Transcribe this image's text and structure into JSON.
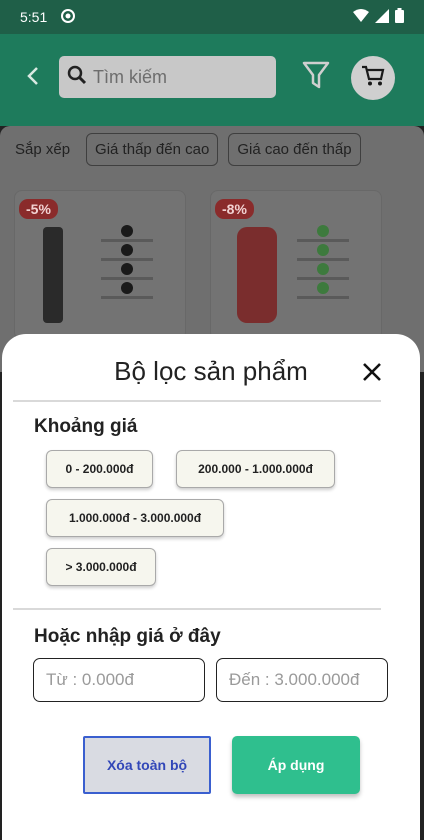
{
  "status_bar": {
    "time": "5:51"
  },
  "header": {
    "search_placeholder": "Tìm kiếm"
  },
  "sort": {
    "label": "Sắp xếp",
    "options": [
      "Giá thấp đến cao",
      "Giá cao đến thấp"
    ]
  },
  "products": [
    {
      "discount": "-5%"
    },
    {
      "discount": "-8%"
    }
  ],
  "filter_sheet": {
    "title": "Bộ lọc sản phẩm",
    "price_range_title": "Khoảng giá",
    "price_ranges": [
      "0 - 200.000đ",
      "200.000 - 1.000.000đ",
      "1.000.000đ - 3.000.000đ",
      "> 3.000.000đ"
    ],
    "manual_title": "Hoặc nhập giá ở đây",
    "from_placeholder": "Từ : 0.000đ",
    "to_placeholder": "Đến : 3.000.000đ",
    "clear_label": "Xóa toàn bộ",
    "apply_label": "Áp dụng"
  },
  "colors": {
    "brand_green": "#2fbf8e",
    "header_green": "#1e7b5c",
    "discount_red": "#e24a4a",
    "clear_blue": "#3a5fcf"
  },
  "icons": [
    "back-arrow-icon",
    "search-icon",
    "filter-icon",
    "cart-icon",
    "close-icon",
    "wifi-icon",
    "signal-icon",
    "battery-icon"
  ]
}
